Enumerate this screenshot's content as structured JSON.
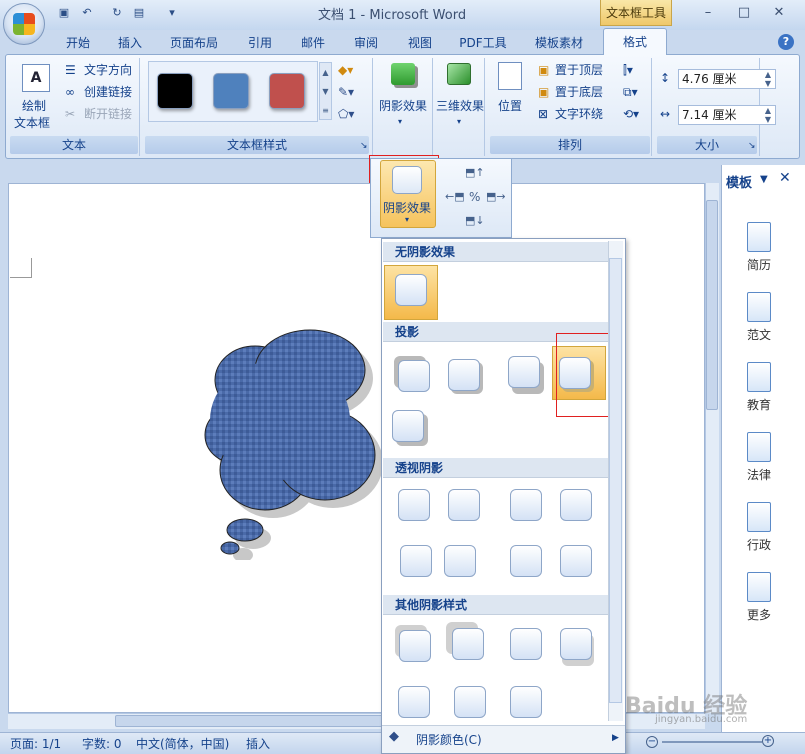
{
  "window": {
    "title": "文档 1 - Microsoft Word",
    "context_tab_group": "文本框工具",
    "controls": {
      "minimize": "–",
      "maximize": "□",
      "close": "✕"
    }
  },
  "qat": {
    "save_icon": "save-icon",
    "undo_icon": "undo-icon",
    "redo_icon": "redo-icon",
    "separator": "▾"
  },
  "tabs": [
    "开始",
    "插入",
    "页面布局",
    "引用",
    "邮件",
    "审阅",
    "视图",
    "PDF工具",
    "模板素材"
  ],
  "active_tab": "格式",
  "help": "?",
  "ribbon": {
    "text_group": {
      "draw_label_1": "绘制",
      "draw_label_2": "文本框",
      "text_direction": "文字方向",
      "create_link": "创建链接",
      "break_link": "断开链接",
      "label": "文本"
    },
    "styles_group": {
      "label": "文本框样式",
      "swatches": [
        "#000000",
        "#4f81bd",
        "#c0504d"
      ]
    },
    "shadow_group": {
      "shadow_label": "阴影效果"
    },
    "three_d_group": {
      "label": "三维效果"
    },
    "arrange_group": {
      "position": "位置",
      "bring_front": "置于顶层",
      "send_back": "置于底层",
      "text_wrap": "文字环绕",
      "label": "排列"
    },
    "size_group": {
      "height": "4.76 厘米",
      "width": "7.14 厘米",
      "label": "大小"
    }
  },
  "subpanel": {
    "shadow_label": "阴影效果"
  },
  "dropdown": {
    "sections": [
      "无阴影效果",
      "投影",
      "透视阴影",
      "其他阴影样式"
    ],
    "footer": "阴影颜色(C)"
  },
  "taskpane": {
    "title": "模板",
    "items": [
      "简历",
      "范文",
      "教育",
      "法律",
      "行政",
      "更多"
    ]
  },
  "status": {
    "page": "页面: 1/1",
    "words": "字数: 0",
    "language": "中文(简体，中国)",
    "mode": "插入"
  },
  "watermark": "Baidu 经验",
  "watermark_url": "jingyan.baidu.com",
  "colors": {
    "accent": "#15428b",
    "highlight": "#f6c35d",
    "shape": "#4a6aa8"
  }
}
